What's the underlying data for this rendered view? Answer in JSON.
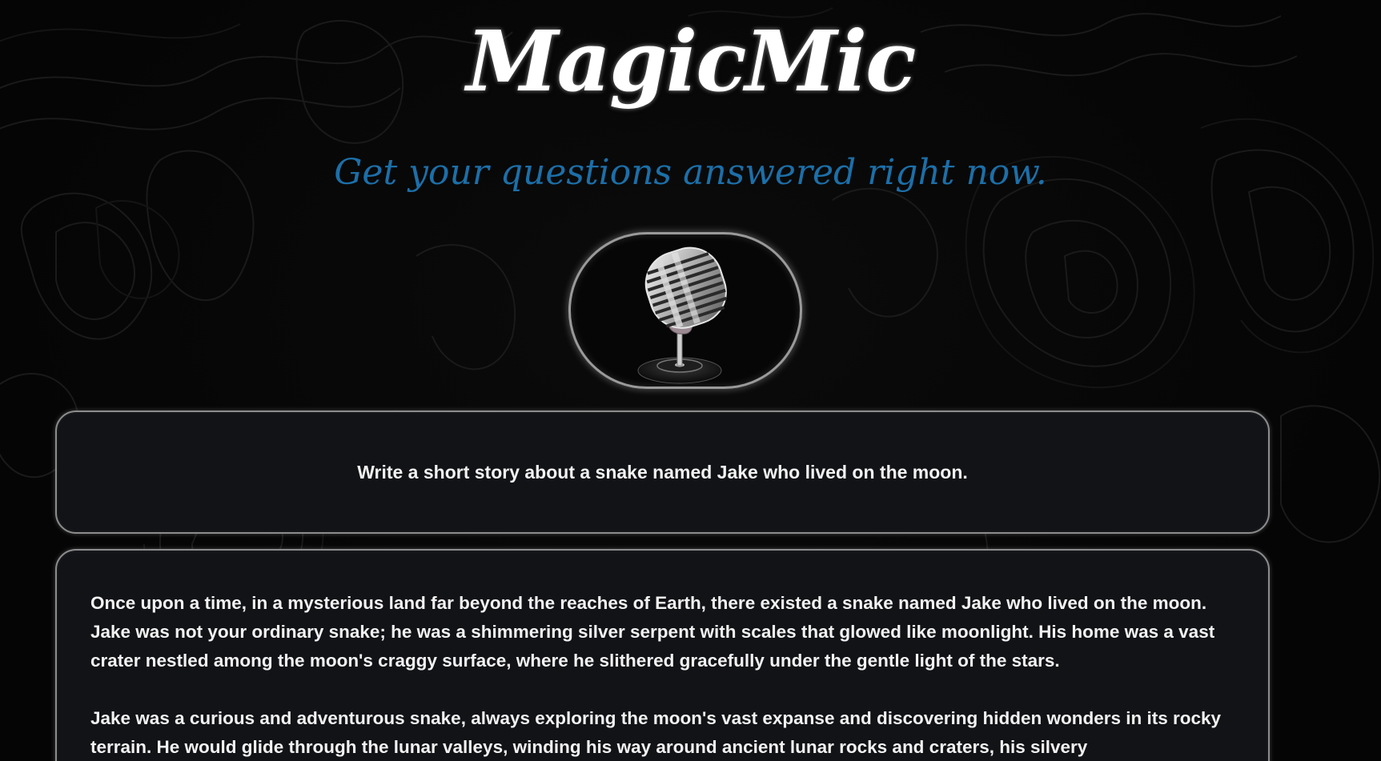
{
  "header": {
    "title": "MagicMic",
    "subtitle": "Get your questions answered right now."
  },
  "mic": {
    "icon": "microphone-icon"
  },
  "prompt": {
    "text": "Write a short story about a snake named Jake who lived on the moon."
  },
  "answer": {
    "paragraphs": [
      "Once upon a time, in a mysterious land far beyond the reaches of Earth, there existed a snake named Jake who lived on the moon. Jake was not your ordinary snake; he was a shimmering silver serpent with scales that glowed like moonlight. His home was a vast crater nestled among the moon's craggy surface, where he slithered gracefully under the gentle light of the stars.",
      "Jake was a curious and adventurous snake, always exploring the moon's vast expanse and discovering hidden wonders in its rocky terrain. He would glide through the lunar valleys, winding his way around ancient lunar rocks and craters, his silvery"
    ]
  },
  "colors": {
    "background": "#050505",
    "title": "#ffffff",
    "subtitle": "#1c6fa8",
    "card_background": "#111316",
    "card_border": "#8c8c8c",
    "text": "#f2f2f2"
  }
}
